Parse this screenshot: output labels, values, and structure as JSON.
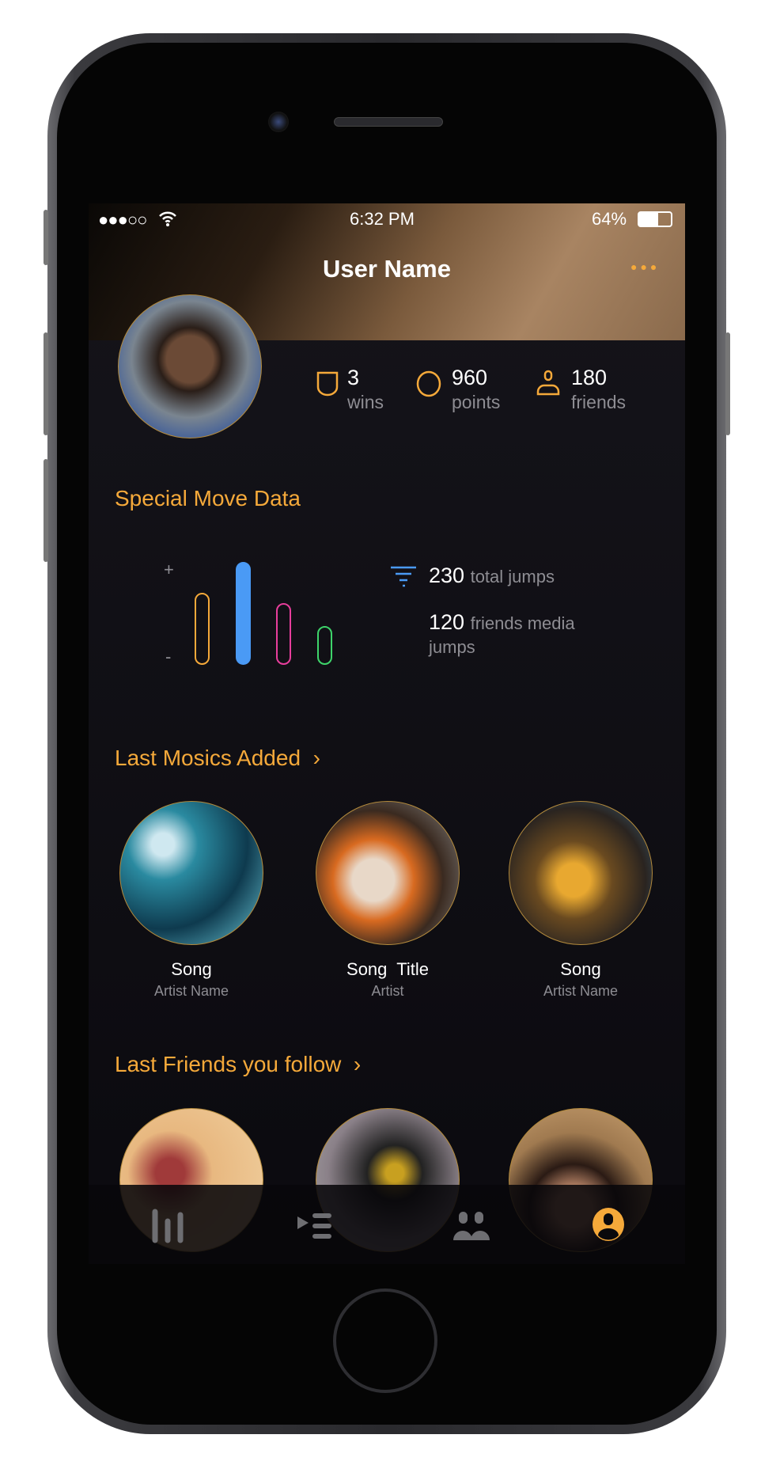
{
  "status": {
    "signal": "●●●○○",
    "time": "6:32 PM",
    "battery": "64%"
  },
  "header": {
    "title": "User Name",
    "more_icon": "more-icon"
  },
  "stats": [
    {
      "value": "3",
      "label": "wins",
      "icon": "shield-icon"
    },
    {
      "value": "960",
      "label": "points",
      "icon": "circle-icon"
    },
    {
      "value": "180",
      "label": "friends",
      "icon": "person-icon"
    }
  ],
  "special": {
    "title": "Special Move Data",
    "plus": "+",
    "minus": "-",
    "bars": [
      {
        "color": "#f5a93a",
        "level": 0.7,
        "filled": false
      },
      {
        "color": "#4a9af5",
        "level": 1.0,
        "filled": true
      },
      {
        "color": "#e83e9c",
        "level": 0.6,
        "filled": false
      },
      {
        "color": "#3ed46a",
        "level": 0.38,
        "filled": false
      }
    ],
    "total_value": "230",
    "total_label": "total jumps",
    "friends_value": "120",
    "friends_label": "friends media jumps"
  },
  "music": {
    "title": "Last Mosics Added",
    "chevron": "›",
    "items": [
      {
        "title": "Song",
        "artist": "Artist Name"
      },
      {
        "title": "Song  Title",
        "artist": "Artist"
      },
      {
        "title": "Song",
        "artist": "Artist Name"
      }
    ]
  },
  "friends": {
    "title": "Last Friends you follow",
    "chevron": "›"
  },
  "tabs": [
    {
      "name": "stats"
    },
    {
      "name": "playlist"
    },
    {
      "name": "friends"
    },
    {
      "name": "profile",
      "active": true
    }
  ],
  "colors": {
    "accent": "#f5a93a",
    "inactive": "#6e6e72"
  }
}
